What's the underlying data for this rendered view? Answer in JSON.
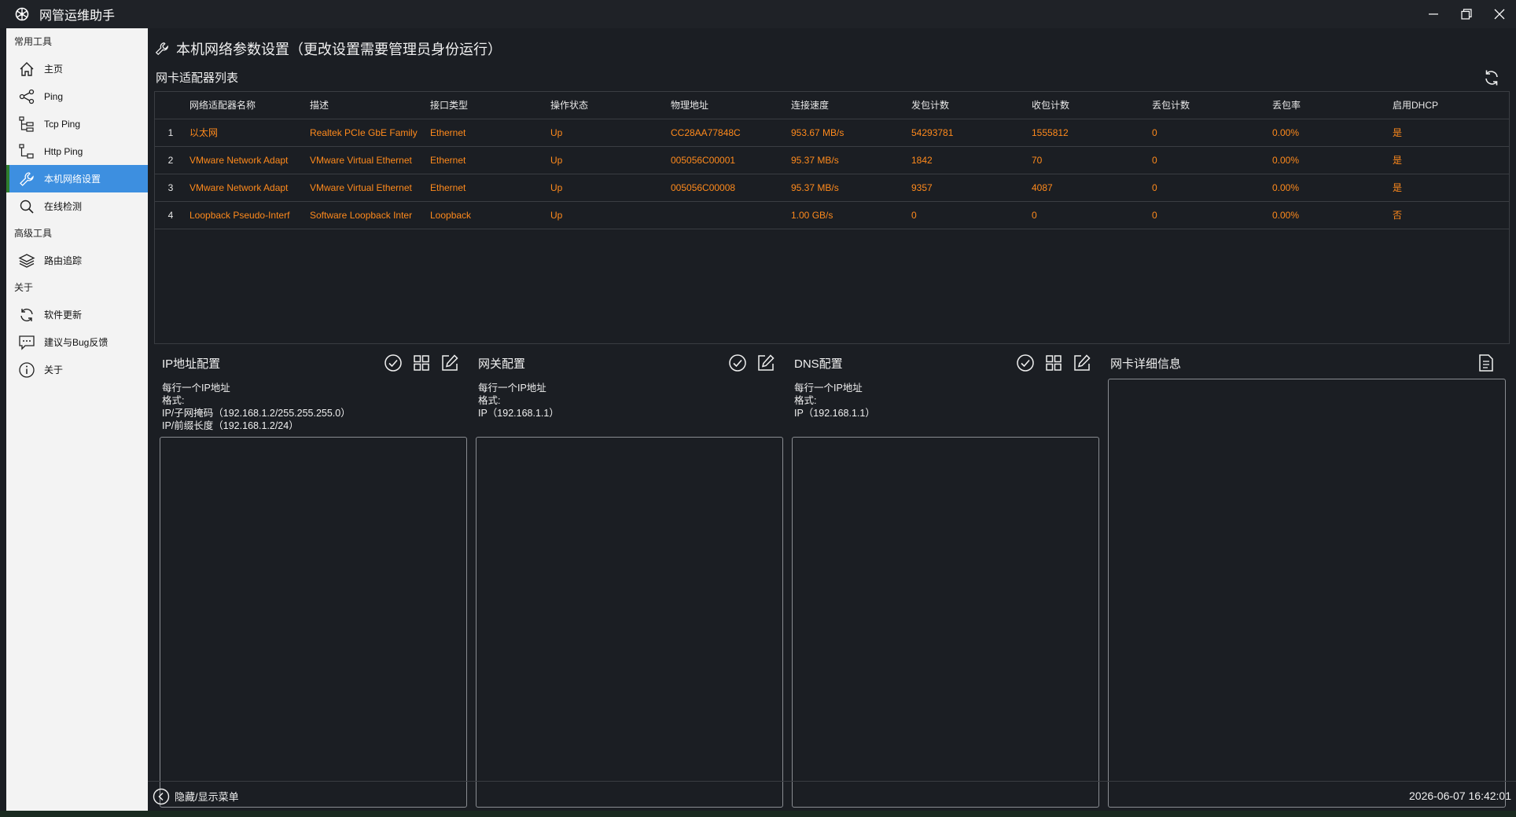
{
  "app": {
    "title": "网管运维助手"
  },
  "sidebar": {
    "sections": [
      {
        "label": "常用工具",
        "items": [
          {
            "label": "主页",
            "icon": "home-icon"
          },
          {
            "label": "Ping",
            "icon": "share-icon"
          },
          {
            "label": "Tcp Ping",
            "icon": "tree-icon"
          },
          {
            "label": "Http Ping",
            "icon": "tree-branch-icon"
          },
          {
            "label": "本机网络设置",
            "icon": "wrench-icon",
            "active": true
          },
          {
            "label": "在线检测",
            "icon": "search-icon"
          }
        ]
      },
      {
        "label": "高级工具",
        "items": [
          {
            "label": "路由追踪",
            "icon": "layers-icon"
          }
        ]
      },
      {
        "label": "关于",
        "items": [
          {
            "label": "软件更新",
            "icon": "sync-icon"
          },
          {
            "label": "建议与Bug反馈",
            "icon": "comment-icon"
          },
          {
            "label": "关于",
            "icon": "info-icon"
          }
        ]
      }
    ]
  },
  "main": {
    "title": "本机网络参数设置（更改设置需要管理员身份运行）",
    "list_title": "网卡适配器列表",
    "table": {
      "headers": [
        "",
        "网络适配器名称",
        "描述",
        "接口类型",
        "操作状态",
        "物理地址",
        "连接速度",
        "发包计数",
        "收包计数",
        "丢包计数",
        "丢包率",
        "启用DHCP"
      ],
      "rows": [
        [
          "1",
          "以太网",
          "Realtek PCIe GbE Family",
          "Ethernet",
          "Up",
          "CC28AA77848C",
          "953.67 MB/s",
          "54293781",
          "1555812",
          "0",
          "0.00%",
          "是"
        ],
        [
          "2",
          "VMware Network Adapt",
          "VMware Virtual Ethernet",
          "Ethernet",
          "Up",
          "005056C00001",
          "95.37 MB/s",
          "1842",
          "70",
          "0",
          "0.00%",
          "是"
        ],
        [
          "3",
          "VMware Network Adapt",
          "VMware Virtual Ethernet",
          "Ethernet",
          "Up",
          "005056C00008",
          "95.37 MB/s",
          "9357",
          "4087",
          "0",
          "0.00%",
          "是"
        ],
        [
          "4",
          "Loopback Pseudo-Interf",
          "Software Loopback Inter",
          "Loopback",
          "Up",
          "",
          "1.00 GB/s",
          "0",
          "0",
          "0",
          "0.00%",
          "否"
        ]
      ]
    },
    "ip_panel": {
      "title": "IP地址配置",
      "hint": "每行一个IP地址\n格式:\nIP/子网掩码（192.168.1.2/255.255.255.0）\nIP/前缀长度（192.168.1.2/24）",
      "value": ""
    },
    "gateway_panel": {
      "title": "网关配置",
      "hint": "每行一个IP地址\n格式:\nIP（192.168.1.1）",
      "value": ""
    },
    "dns_panel": {
      "title": "DNS配置",
      "hint": "每行一个IP地址\n格式:\nIP（192.168.1.1）",
      "value": ""
    },
    "detail_panel": {
      "title": "网卡详细信息"
    }
  },
  "status": {
    "toggle_label": "隐藏/显示菜单",
    "clock": "2026-06-07 16:42:01"
  },
  "colors": {
    "accent": "#3d8fe0",
    "value_text": "#ff8a1c",
    "background": "#1b1e23"
  }
}
